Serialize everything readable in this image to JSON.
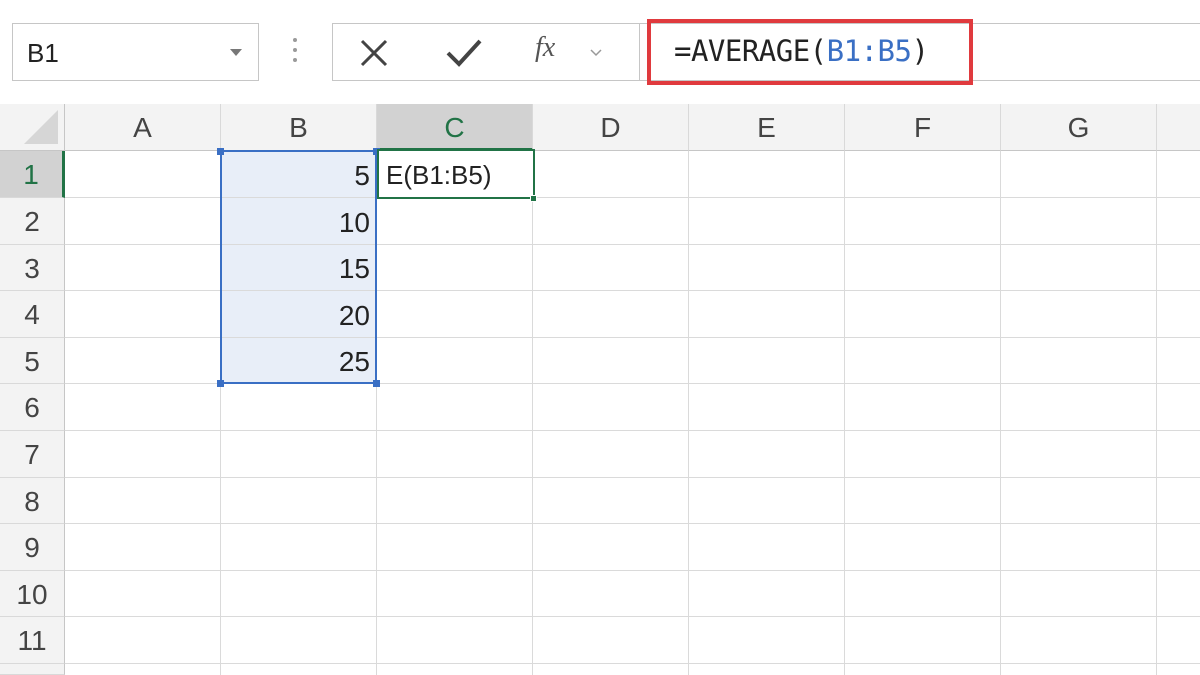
{
  "formula_bar": {
    "name_box": "B1",
    "formula": {
      "prefix": "=AVERAGE(",
      "reference": "B1:B5",
      "suffix": ")"
    },
    "icons": {
      "cancel": "close-icon",
      "enter": "check-icon",
      "insert_function": "fx-icon"
    },
    "fx_label": "fx",
    "highlight_color": "#e03a3e"
  },
  "grid": {
    "columns": [
      "A",
      "B",
      "C",
      "D",
      "E",
      "F",
      "G"
    ],
    "active_column": "C",
    "rows": [
      "1",
      "2",
      "3",
      "4",
      "5",
      "6",
      "7",
      "8",
      "9",
      "10",
      "11"
    ],
    "active_row": "1",
    "cells": {
      "B1": "5",
      "B2": "10",
      "B3": "15",
      "B4": "20",
      "B5": "25",
      "C1": "E(B1:B5)"
    },
    "selected_range": "B1:B5",
    "range_color": "#3a6fc4",
    "accent_color": "#217346"
  }
}
